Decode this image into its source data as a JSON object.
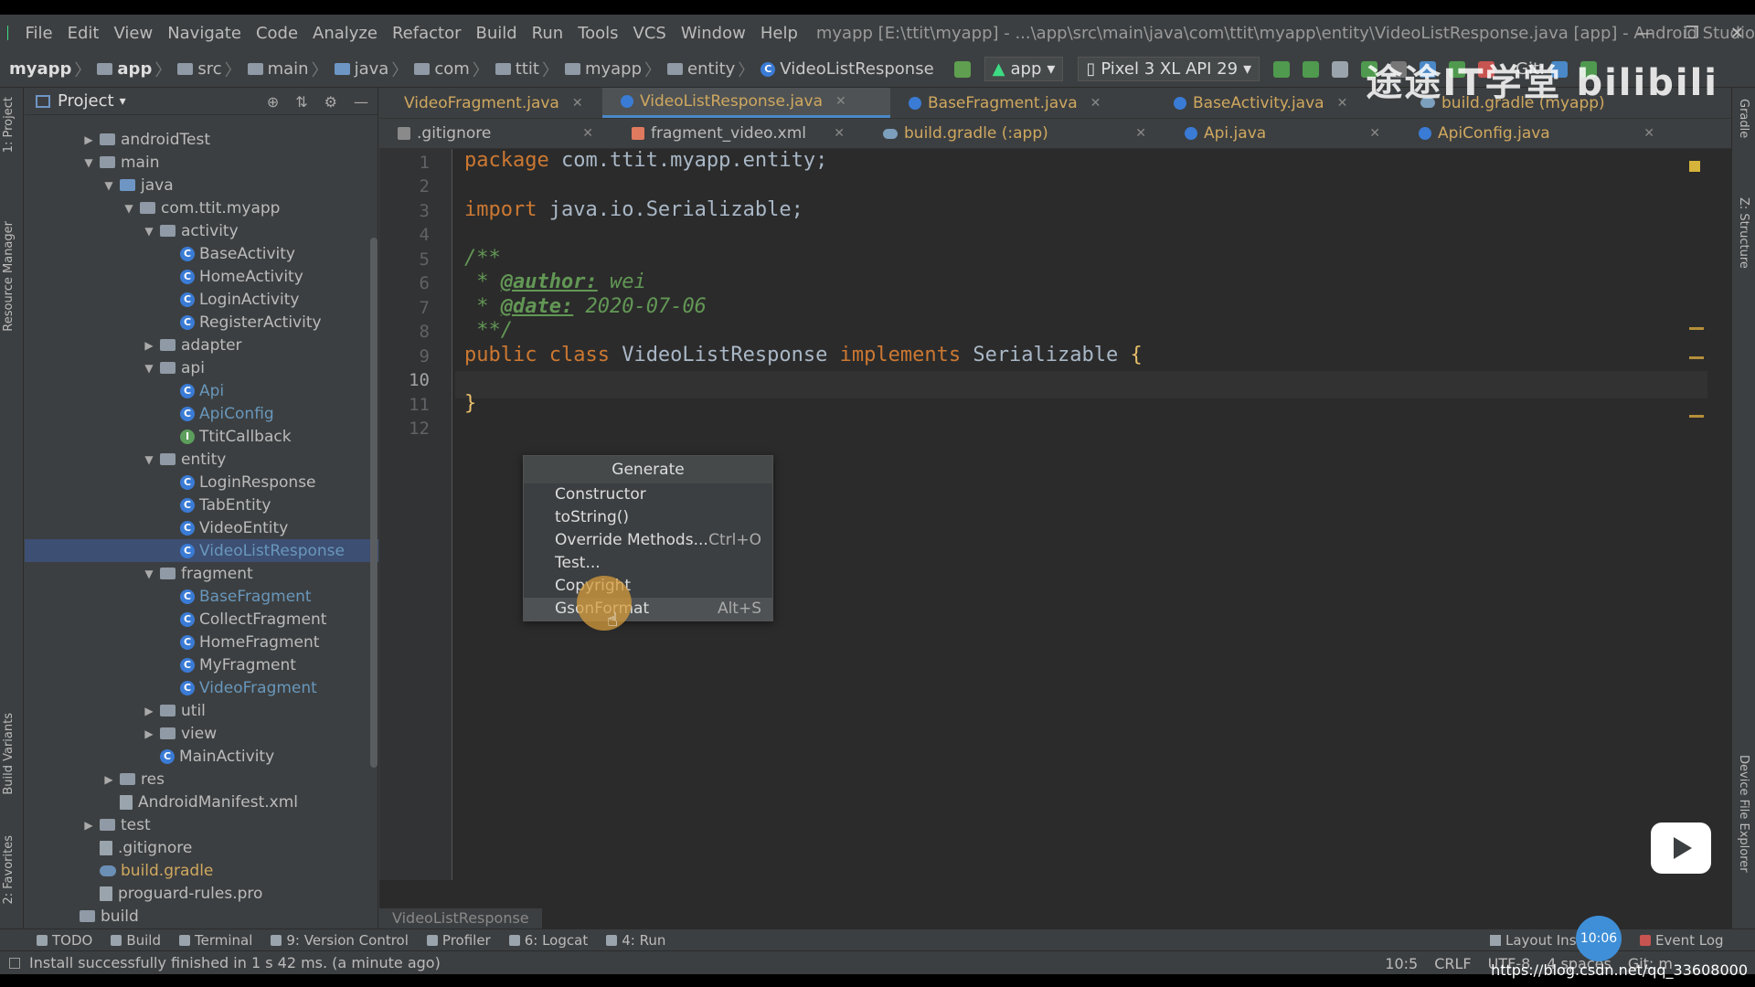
{
  "menubar": {
    "items": [
      "File",
      "Edit",
      "View",
      "Navigate",
      "Code",
      "Analyze",
      "Refactor",
      "Build",
      "Run",
      "Tools",
      "VCS",
      "Window",
      "Help"
    ],
    "window_title": "myapp [E:\\ttit\\myapp] - ...\\app\\src\\main\\java\\com\\ttit\\myapp\\entity\\VideoListResponse.java [app] - Android Studio"
  },
  "breadcrumb": [
    "myapp",
    "app",
    "src",
    "main",
    "java",
    "com",
    "ttit",
    "myapp",
    "entity",
    "VideoListResponse"
  ],
  "toolbar": {
    "run_config": "app",
    "device": "Pixel 3 XL API 29",
    "git_label": "Git:"
  },
  "left_strip": {
    "project": "1: Project",
    "resource_manager": "Resource Manager",
    "build_variants": "Build Variants",
    "favorites": "2: Favorites"
  },
  "right_strip": {
    "gradle": "Gradle",
    "structure": "Z: Structure",
    "device_explorer": "Device File Explorer"
  },
  "project_panel": {
    "title": "Project",
    "tree": [
      {
        "label": "androidTest",
        "kind": "folder",
        "arrow": "▶"
      },
      {
        "label": "main",
        "kind": "folder",
        "arrow": "▼"
      },
      {
        "label": "java",
        "kind": "folder-blue",
        "arrow": "▼"
      },
      {
        "label": "com.ttit.myapp",
        "kind": "folder",
        "arrow": "▼"
      },
      {
        "label": "activity",
        "kind": "folder",
        "arrow": "▼"
      },
      {
        "label": "BaseActivity",
        "kind": "class"
      },
      {
        "label": "HomeActivity",
        "kind": "class"
      },
      {
        "label": "LoginActivity",
        "kind": "class"
      },
      {
        "label": "RegisterActivity",
        "kind": "class"
      },
      {
        "label": "adapter",
        "kind": "folder",
        "arrow": "▶"
      },
      {
        "label": "api",
        "kind": "folder",
        "arrow": "▼"
      },
      {
        "label": "Api",
        "kind": "class",
        "color": "blue"
      },
      {
        "label": "ApiConfig",
        "kind": "class",
        "color": "blue"
      },
      {
        "label": "TtitCallback",
        "kind": "interface"
      },
      {
        "label": "entity",
        "kind": "folder",
        "arrow": "▼"
      },
      {
        "label": "LoginResponse",
        "kind": "class"
      },
      {
        "label": "TabEntity",
        "kind": "class"
      },
      {
        "label": "VideoEntity",
        "kind": "class"
      },
      {
        "label": "VideoListResponse",
        "kind": "class",
        "color": "blue",
        "selected": true
      },
      {
        "label": "fragment",
        "kind": "folder",
        "arrow": "▼"
      },
      {
        "label": "BaseFragment",
        "kind": "class",
        "color": "blue"
      },
      {
        "label": "CollectFragment",
        "kind": "class"
      },
      {
        "label": "HomeFragment",
        "kind": "class"
      },
      {
        "label": "MyFragment",
        "kind": "class"
      },
      {
        "label": "VideoFragment",
        "kind": "class",
        "color": "blue"
      },
      {
        "label": "util",
        "kind": "folder",
        "arrow": "▶"
      },
      {
        "label": "view",
        "kind": "folder",
        "arrow": "▶"
      },
      {
        "label": "MainActivity",
        "kind": "class"
      },
      {
        "label": "res",
        "kind": "folder",
        "arrow": "▶"
      },
      {
        "label": "AndroidManifest.xml",
        "kind": "file"
      },
      {
        "label": "test",
        "kind": "folder",
        "arrow": "▶"
      },
      {
        "label": ".gitignore",
        "kind": "file"
      },
      {
        "label": "build.gradle",
        "kind": "gradle",
        "color": "orange"
      },
      {
        "label": "proguard-rules.pro",
        "kind": "file"
      },
      {
        "label": "build",
        "kind": "folder"
      }
    ]
  },
  "editor": {
    "tabs_row1": [
      {
        "label": "VideoFragment.java",
        "icon": "class"
      },
      {
        "label": "VideoListResponse.java",
        "icon": "class",
        "active": true
      },
      {
        "label": "BaseFragment.java",
        "icon": "class"
      },
      {
        "label": "BaseActivity.java",
        "icon": "class"
      },
      {
        "label": "build.gradle (myapp)",
        "icon": "gradle"
      }
    ],
    "tabs_row2": [
      {
        "label": ".gitignore",
        "icon": "git"
      },
      {
        "label": "fragment_video.xml",
        "icon": "xml"
      },
      {
        "label": "build.gradle (:app)",
        "icon": "gradle"
      },
      {
        "label": "Api.java",
        "icon": "class"
      },
      {
        "label": "ApiConfig.java",
        "icon": "class"
      }
    ],
    "line_numbers": [
      "1",
      "2",
      "3",
      "4",
      "5",
      "6",
      "7",
      "8",
      "9",
      "10",
      "11",
      "12"
    ],
    "code": {
      "l1_kw": "package",
      "l1_rest": " com.ttit.myapp.entity;",
      "l3_kw": "import",
      "l3_rest": " java.io.Serializable;",
      "l5": "/**",
      "l6_pre": " * ",
      "l6_tag": "@author:",
      "l6_val": " wei",
      "l7_pre": " * ",
      "l7_tag": "@date:",
      "l7_val": " 2020-07-06",
      "l8": " **/",
      "l9_kw1": "public class",
      "l9_name": " VideoListResponse ",
      "l9_kw2": "implements",
      "l9_iface": " Serializable ",
      "l9_brace": "{",
      "l11": "}"
    },
    "bottom_crumb": "VideoListResponse"
  },
  "generate_popup": {
    "title": "Generate",
    "items": [
      {
        "label": "Constructor",
        "shortcut": ""
      },
      {
        "label": "toString()",
        "shortcut": ""
      },
      {
        "label": "Override Methods...",
        "shortcut": "Ctrl+O"
      },
      {
        "label": "Test...",
        "shortcut": ""
      },
      {
        "label": "Copyright",
        "shortcut": ""
      },
      {
        "label": "GsonFormat",
        "shortcut": "Alt+S",
        "highlighted": true
      }
    ]
  },
  "bottom_tabs": [
    "TODO",
    "Build",
    "Terminal",
    "9: Version Control",
    "Profiler",
    "6: Logcat",
    "4: Run"
  ],
  "bottom_right_tabs": {
    "layout": "Layout Insp",
    "event_log": "Event Log"
  },
  "status": {
    "message": "Install successfully finished in 1 s 42 ms. (a minute ago)",
    "position": "10:5",
    "line_sep": "CRLF",
    "encoding": "UTF-8",
    "indent": "4 spaces",
    "git": "Git: m"
  },
  "overlay": {
    "watermark": "途途IT学堂 bilibili",
    "time_badge": "10:06",
    "url": "https://blog.csdn.net/qq_33608000"
  },
  "colors": {
    "accent": "#4a88c7",
    "keyword": "#cc7832",
    "doc": "#629755",
    "class_icon": "#3a7bd5"
  }
}
